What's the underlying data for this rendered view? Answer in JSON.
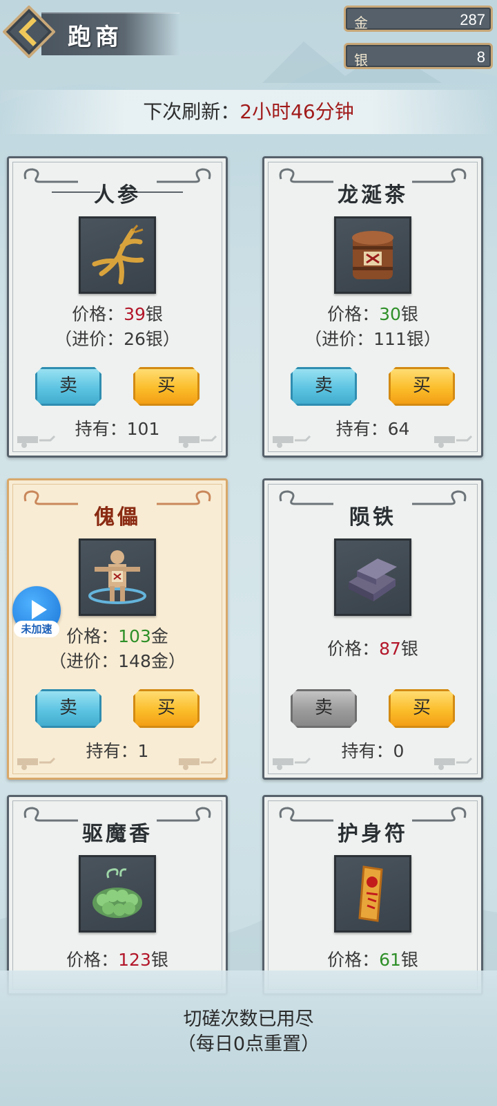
{
  "header": {
    "title": "跑商",
    "currencies": [
      {
        "label": "金",
        "value": "287"
      },
      {
        "label": "银",
        "value": "8"
      }
    ]
  },
  "refresh": {
    "label": "下次刷新：",
    "time": "2小时46分钟"
  },
  "items": [
    {
      "name": "人参",
      "icon": "ginseng-icon",
      "price_label": "价格：",
      "price_value": "39",
      "price_unit": "银",
      "price_color": "red",
      "cost": "（进价：26银）",
      "sell_label": "卖",
      "buy_label": "买",
      "holding": "持有：101"
    },
    {
      "name": "龙涎茶",
      "icon": "tea-barrel-icon",
      "price_label": "价格：",
      "price_value": "30",
      "price_unit": "银",
      "price_color": "green",
      "cost": "（进价：111银）",
      "sell_label": "卖",
      "buy_label": "买",
      "holding": "持有：64"
    },
    {
      "name": "傀儡",
      "icon": "puppet-icon",
      "price_label": "价格：",
      "price_value": "103",
      "price_unit": "金",
      "price_color": "green",
      "cost": "（进价：148金）",
      "sell_label": "卖",
      "buy_label": "买",
      "holding": "持有：1"
    },
    {
      "name": "陨铁",
      "icon": "meteoric-iron-icon",
      "price_label": "价格：",
      "price_value": "87",
      "price_unit": "银",
      "price_color": "red",
      "sell_label": "卖",
      "buy_label": "买",
      "holding": "持有：0"
    },
    {
      "name": "驱魔香",
      "icon": "incense-icon",
      "price_label": "价格：",
      "price_value": "123",
      "price_unit": "银",
      "price_color": "red"
    },
    {
      "name": "护身符",
      "icon": "talisman-icon",
      "price_label": "价格：",
      "price_value": "61",
      "price_unit": "银",
      "price_color": "green"
    }
  ],
  "speed_badge": {
    "label": "未加速"
  },
  "footer": {
    "line1": "切磋次数已用尽",
    "line2": "（每日0点重置）"
  },
  "colors": {
    "price_red": "#b3162a",
    "price_green": "#2e8f28",
    "sell": "#5cc4e2",
    "buy": "#fbbd2a",
    "disabled": "#9b9b9b"
  }
}
